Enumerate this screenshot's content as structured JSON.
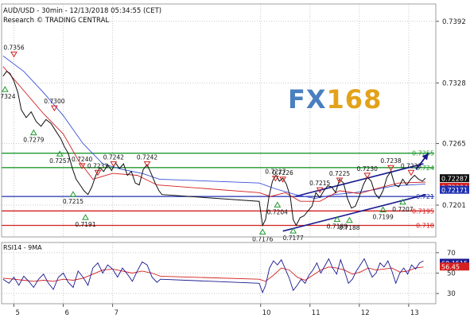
{
  "header": {
    "line1": "AUD/USD - 30min - 12/13/2018 05:34:55 (CET)",
    "line2": "Research © TRADING CENTRAL"
  },
  "logo": {
    "fx": "FX",
    "num": "168"
  },
  "chart_data": [
    {
      "type": "line",
      "panel": "price",
      "x_labels": [
        {
          "day": 5,
          "label": "5"
        },
        {
          "day": 6,
          "label": "6"
        },
        {
          "day": 7,
          "label": "7"
        },
        {
          "day": 10,
          "label": "10"
        },
        {
          "day": 11,
          "label": "11"
        },
        {
          "day": 12,
          "label": "12"
        },
        {
          "day": 13,
          "label": "13"
        }
      ],
      "y_ticks": [
        "0.7392",
        "0.7328",
        "0.7265",
        "0.7201"
      ],
      "y_tick_values": [
        0.7392,
        0.7328,
        0.7265,
        0.7201
      ],
      "ylim": [
        0.7168,
        0.741
      ],
      "xlim": [
        4.75,
        13.55
      ],
      "price_path": [
        [
          4.78,
          0.7335
        ],
        [
          4.85,
          0.734
        ],
        [
          4.92,
          0.7338
        ],
        [
          5.0,
          0.733
        ],
        [
          5.08,
          0.7318
        ],
        [
          5.15,
          0.73
        ],
        [
          5.25,
          0.7292
        ],
        [
          5.35,
          0.7298
        ],
        [
          5.45,
          0.7288
        ],
        [
          5.55,
          0.7283
        ],
        [
          5.65,
          0.729
        ],
        [
          5.75,
          0.7286
        ],
        [
          5.85,
          0.7278
        ],
        [
          5.95,
          0.727
        ],
        [
          6.02,
          0.7262
        ],
        [
          6.1,
          0.7255
        ],
        [
          6.18,
          0.724
        ],
        [
          6.26,
          0.7228
        ],
        [
          6.34,
          0.7222
        ],
        [
          6.42,
          0.7216
        ],
        [
          6.5,
          0.7212
        ],
        [
          6.58,
          0.722
        ],
        [
          6.66,
          0.7232
        ],
        [
          6.74,
          0.724
        ],
        [
          6.82,
          0.7236
        ],
        [
          6.9,
          0.7243
        ],
        [
          6.98,
          0.7237
        ],
        [
          7.06,
          0.7245
        ],
        [
          7.14,
          0.7239
        ],
        [
          7.22,
          0.7244
        ],
        [
          7.3,
          0.7232
        ],
        [
          7.38,
          0.7236
        ],
        [
          7.46,
          0.7224
        ],
        [
          7.54,
          0.7222
        ],
        [
          7.62,
          0.7238
        ],
        [
          7.7,
          0.7243
        ],
        [
          7.78,
          0.7234
        ],
        [
          7.86,
          0.7224
        ],
        [
          7.94,
          0.7216
        ],
        [
          8.0,
          0.7212
        ],
        [
          9.97,
          0.7205
        ],
        [
          10.04,
          0.718
        ],
        [
          10.1,
          0.7186
        ],
        [
          10.17,
          0.721
        ],
        [
          10.24,
          0.7226
        ],
        [
          10.31,
          0.7232
        ],
        [
          10.38,
          0.7226
        ],
        [
          10.45,
          0.7229
        ],
        [
          10.52,
          0.7223
        ],
        [
          10.6,
          0.721
        ],
        [
          10.66,
          0.7186
        ],
        [
          10.72,
          0.718
        ],
        [
          10.8,
          0.7188
        ],
        [
          10.88,
          0.719
        ],
        [
          10.96,
          0.7195
        ],
        [
          11.04,
          0.72
        ],
        [
          11.12,
          0.7214
        ],
        [
          11.2,
          0.7209
        ],
        [
          11.28,
          0.7216
        ],
        [
          11.36,
          0.7221
        ],
        [
          11.44,
          0.722
        ],
        [
          11.52,
          0.7214
        ],
        [
          11.6,
          0.7228
        ],
        [
          11.68,
          0.7224
        ],
        [
          11.76,
          0.7208
        ],
        [
          11.84,
          0.7198
        ],
        [
          11.92,
          0.72
        ],
        [
          12.0,
          0.721
        ],
        [
          12.08,
          0.7222
        ],
        [
          12.16,
          0.723
        ],
        [
          12.24,
          0.7226
        ],
        [
          12.32,
          0.7213
        ],
        [
          12.4,
          0.7208
        ],
        [
          12.48,
          0.7216
        ],
        [
          12.56,
          0.723
        ],
        [
          12.64,
          0.7236
        ],
        [
          12.72,
          0.7222
        ],
        [
          12.8,
          0.722
        ],
        [
          12.88,
          0.7228
        ],
        [
          12.96,
          0.7222
        ],
        [
          13.04,
          0.7228
        ],
        [
          13.12,
          0.7232
        ],
        [
          13.2,
          0.7228
        ],
        [
          13.28,
          0.7226
        ],
        [
          13.34,
          0.7229
        ]
      ],
      "ma_fast": [
        [
          4.78,
          0.7345
        ],
        [
          5.2,
          0.732
        ],
        [
          5.6,
          0.7296
        ],
        [
          6.0,
          0.7275
        ],
        [
          6.3,
          0.7248
        ],
        [
          6.6,
          0.7228
        ],
        [
          7.0,
          0.7234
        ],
        [
          7.5,
          0.7232
        ],
        [
          7.9,
          0.7222
        ],
        [
          9.97,
          0.7214
        ],
        [
          10.2,
          0.721
        ],
        [
          10.5,
          0.7214
        ],
        [
          10.8,
          0.7205
        ],
        [
          11.2,
          0.7205
        ],
        [
          11.6,
          0.7216
        ],
        [
          12.0,
          0.7213
        ],
        [
          12.4,
          0.7219
        ],
        [
          12.8,
          0.7224
        ],
        [
          13.34,
          0.7225
        ]
      ],
      "ma_slow": [
        [
          4.78,
          0.7356
        ],
        [
          5.2,
          0.734
        ],
        [
          5.6,
          0.7318
        ],
        [
          6.0,
          0.7294
        ],
        [
          6.4,
          0.7265
        ],
        [
          6.8,
          0.7244
        ],
        [
          7.2,
          0.7238
        ],
        [
          7.6,
          0.7234
        ],
        [
          7.95,
          0.7228
        ],
        [
          9.97,
          0.7224
        ],
        [
          10.3,
          0.7218
        ],
        [
          10.7,
          0.7212
        ],
        [
          11.1,
          0.7208
        ],
        [
          11.5,
          0.7212
        ],
        [
          11.9,
          0.7214
        ],
        [
          12.3,
          0.7217
        ],
        [
          12.7,
          0.7221
        ],
        [
          13.34,
          0.7223
        ]
      ],
      "horizontal_levels": [
        {
          "value": 0.7255,
          "label": "0.7255",
          "color": "#1f9a2e"
        },
        {
          "value": 0.724,
          "label": "0.724",
          "color": "#1f9a2e"
        },
        {
          "value": 0.721,
          "label": "0.721",
          "color": "#2030b0"
        },
        {
          "value": 0.7195,
          "label": "0.7195",
          "color": "#d42020"
        },
        {
          "value": 0.718,
          "label": "0.718",
          "color": "#d42020"
        }
      ],
      "channel": {
        "color": "#1a1a90",
        "upper": [
          [
            10.7,
            0.721
          ],
          [
            13.3,
            0.7244
          ]
        ],
        "lower": [
          [
            10.45,
            0.7174
          ],
          [
            13.35,
            0.7212
          ]
        ]
      },
      "projection_arrow": {
        "from": [
          13.15,
          0.7238
        ],
        "to": [
          13.4,
          0.7255
        ],
        "color": "#1a1a90"
      },
      "price_boxes": [
        {
          "value": 0.7229,
          "label": "0.72287",
          "bg": "#111111",
          "fg": "#ffffff"
        },
        {
          "value": 0.722,
          "label": "0.72204",
          "bg": "#d42020",
          "fg": "#ffffff"
        },
        {
          "value": 0.7217,
          "label": "0.72171",
          "bg": "#2030b0",
          "fg": "#ffffff"
        }
      ],
      "swing_highs": [
        {
          "x": 5.0,
          "y": 0.7356,
          "label": "0.7356"
        },
        {
          "x": 5.82,
          "y": 0.73,
          "label": "0.7300"
        },
        {
          "x": 6.38,
          "y": 0.724,
          "label": "0.7240"
        },
        {
          "x": 6.7,
          "y": 0.7233,
          "label": "0.7233"
        },
        {
          "x": 7.02,
          "y": 0.7242,
          "label": "0.7242"
        },
        {
          "x": 7.7,
          "y": 0.7242,
          "label": "0.7242"
        },
        {
          "x": 10.3,
          "y": 0.7227,
          "label": "0.7227"
        },
        {
          "x": 10.45,
          "y": 0.7226,
          "label": "0.7226"
        },
        {
          "x": 11.2,
          "y": 0.7215,
          "label": "0.7215"
        },
        {
          "x": 11.6,
          "y": 0.7225,
          "label": "0.7225"
        },
        {
          "x": 12.16,
          "y": 0.723,
          "label": "0.7230"
        },
        {
          "x": 12.64,
          "y": 0.7238,
          "label": "0.7238"
        },
        {
          "x": 13.05,
          "y": 0.7233,
          "label": "0.7233"
        }
      ],
      "swing_lows": [
        {
          "x": 4.82,
          "y": 0.7324,
          "label": "0.7324"
        },
        {
          "x": 5.4,
          "y": 0.7279,
          "label": "0.7279"
        },
        {
          "x": 5.93,
          "y": 0.7257,
          "label": "0.7257"
        },
        {
          "x": 6.2,
          "y": 0.7215,
          "label": "0.7215"
        },
        {
          "x": 6.45,
          "y": 0.7191,
          "label": "0.7191"
        },
        {
          "x": 10.04,
          "y": 0.7176,
          "label": "0.7176"
        },
        {
          "x": 10.34,
          "y": 0.7204,
          "label": "0.7204"
        },
        {
          "x": 10.66,
          "y": 0.7177,
          "label": "0.7177"
        },
        {
          "x": 11.55,
          "y": 0.7189,
          "label": "0.7189"
        },
        {
          "x": 11.8,
          "y": 0.7188,
          "label": "0.7188"
        },
        {
          "x": 12.48,
          "y": 0.7199,
          "label": "0.7199"
        },
        {
          "x": 12.88,
          "y": 0.7207,
          "label": "0.7207"
        }
      ]
    },
    {
      "type": "line",
      "panel": "rsi",
      "title": "RSI14 - 9MA",
      "y_ticks": [
        "70",
        "50",
        "30"
      ],
      "y_tick_values": [
        70,
        50,
        30
      ],
      "ylim": [
        20,
        80
      ],
      "value_boxes": [
        {
          "value": 60.15,
          "label": "60.1515",
          "bg": "#1a1a90",
          "fg": "#ffffff"
        },
        {
          "value": 56.45,
          "label": "56.45",
          "bg": "#d42020",
          "fg": "#ffffff"
        }
      ],
      "rsi": [
        [
          4.78,
          44
        ],
        [
          4.9,
          40
        ],
        [
          5.0,
          46
        ],
        [
          5.1,
          38
        ],
        [
          5.2,
          47
        ],
        [
          5.3,
          42
        ],
        [
          5.4,
          36
        ],
        [
          5.5,
          44
        ],
        [
          5.6,
          49
        ],
        [
          5.7,
          40
        ],
        [
          5.8,
          34
        ],
        [
          5.9,
          46
        ],
        [
          6.0,
          50
        ],
        [
          6.1,
          41
        ],
        [
          6.2,
          36
        ],
        [
          6.3,
          52
        ],
        [
          6.4,
          46
        ],
        [
          6.5,
          38
        ],
        [
          6.6,
          55
        ],
        [
          6.7,
          60
        ],
        [
          6.8,
          50
        ],
        [
          6.9,
          58
        ],
        [
          7.0,
          54
        ],
        [
          7.1,
          46
        ],
        [
          7.2,
          55
        ],
        [
          7.3,
          49
        ],
        [
          7.4,
          42
        ],
        [
          7.5,
          52
        ],
        [
          7.6,
          61
        ],
        [
          7.7,
          58
        ],
        [
          7.8,
          46
        ],
        [
          7.9,
          41
        ],
        [
          7.97,
          44
        ],
        [
          9.97,
          40
        ],
        [
          10.04,
          31
        ],
        [
          10.1,
          38
        ],
        [
          10.18,
          55
        ],
        [
          10.26,
          62
        ],
        [
          10.34,
          58
        ],
        [
          10.42,
          63
        ],
        [
          10.5,
          54
        ],
        [
          10.58,
          45
        ],
        [
          10.66,
          33
        ],
        [
          10.74,
          38
        ],
        [
          10.82,
          44
        ],
        [
          10.9,
          40
        ],
        [
          10.98,
          48
        ],
        [
          11.06,
          53
        ],
        [
          11.14,
          60
        ],
        [
          11.22,
          50
        ],
        [
          11.3,
          57
        ],
        [
          11.38,
          64
        ],
        [
          11.46,
          55
        ],
        [
          11.54,
          49
        ],
        [
          11.62,
          63
        ],
        [
          11.7,
          52
        ],
        [
          11.78,
          40
        ],
        [
          11.86,
          44
        ],
        [
          11.94,
          52
        ],
        [
          12.02,
          58
        ],
        [
          12.1,
          64
        ],
        [
          12.18,
          55
        ],
        [
          12.26,
          46
        ],
        [
          12.34,
          50
        ],
        [
          12.42,
          60
        ],
        [
          12.5,
          56
        ],
        [
          12.58,
          62
        ],
        [
          12.66,
          52
        ],
        [
          12.74,
          40
        ],
        [
          12.82,
          50
        ],
        [
          12.9,
          55
        ],
        [
          12.98,
          49
        ],
        [
          13.06,
          58
        ],
        [
          13.14,
          54
        ],
        [
          13.22,
          60
        ],
        [
          13.3,
          62
        ]
      ],
      "rsi_ma": [
        [
          4.78,
          45
        ],
        [
          5.0,
          44
        ],
        [
          5.2,
          43
        ],
        [
          5.4,
          42
        ],
        [
          5.6,
          43
        ],
        [
          5.8,
          42
        ],
        [
          6.0,
          44
        ],
        [
          6.2,
          43
        ],
        [
          6.4,
          45
        ],
        [
          6.6,
          49
        ],
        [
          6.8,
          53
        ],
        [
          7.0,
          54
        ],
        [
          7.2,
          52
        ],
        [
          7.4,
          50
        ],
        [
          7.6,
          52
        ],
        [
          7.8,
          50
        ],
        [
          7.97,
          47
        ],
        [
          9.97,
          44
        ],
        [
          10.1,
          42
        ],
        [
          10.26,
          48
        ],
        [
          10.42,
          55
        ],
        [
          10.58,
          53
        ],
        [
          10.74,
          46
        ],
        [
          10.9,
          43
        ],
        [
          11.06,
          48
        ],
        [
          11.22,
          53
        ],
        [
          11.38,
          56
        ],
        [
          11.54,
          55
        ],
        [
          11.7,
          53
        ],
        [
          11.86,
          49
        ],
        [
          12.02,
          51
        ],
        [
          12.18,
          55
        ],
        [
          12.34,
          53
        ],
        [
          12.5,
          54
        ],
        [
          12.66,
          55
        ],
        [
          12.82,
          51
        ],
        [
          12.98,
          52
        ],
        [
          13.14,
          55
        ],
        [
          13.3,
          56
        ]
      ]
    }
  ]
}
